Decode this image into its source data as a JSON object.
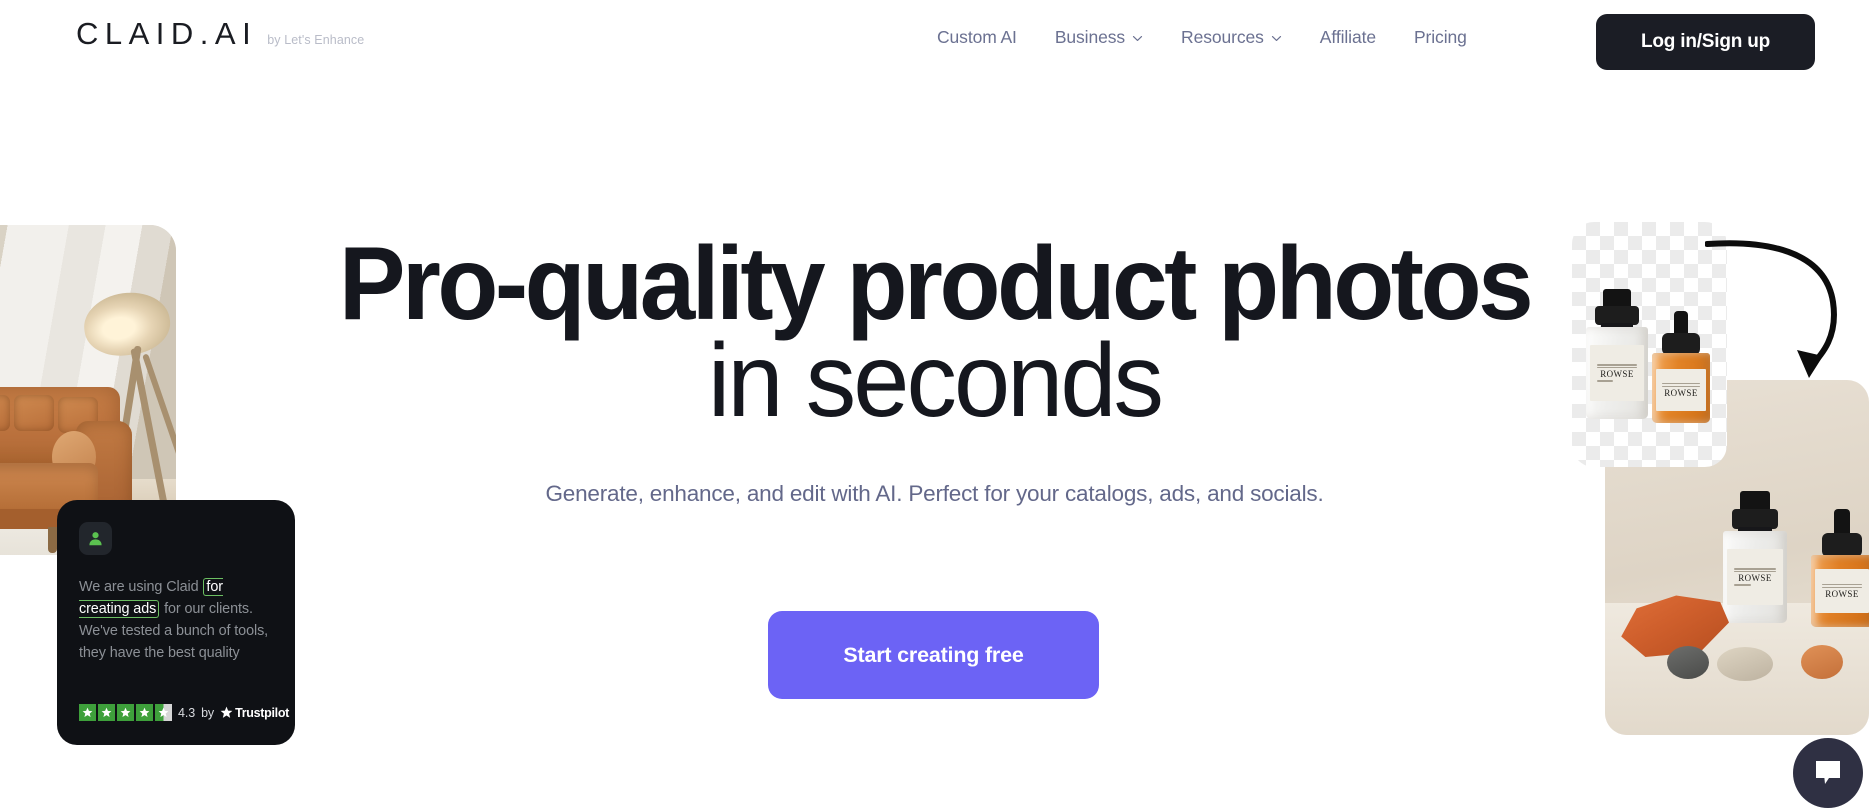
{
  "header": {
    "logo_text": "CLAID.AI",
    "logo_subtitle": "by Let's Enhance",
    "nav_items": [
      {
        "label": "Custom AI",
        "has_dropdown": false
      },
      {
        "label": "Business",
        "has_dropdown": true
      },
      {
        "label": "Resources",
        "has_dropdown": true
      },
      {
        "label": "Affiliate",
        "has_dropdown": false
      },
      {
        "label": "Pricing",
        "has_dropdown": false
      }
    ],
    "login_button": "Log in/Sign up"
  },
  "hero": {
    "headline_line1": "Pro-quality product photos",
    "headline_line2": "in seconds",
    "subheadline": "Generate, enhance, and edit with AI. Perfect for your catalogs, ads, and socials.",
    "cta_label": "Start creating free"
  },
  "testimonial": {
    "quote_before": "We are using Claid ",
    "quote_highlight": "for creating ads",
    "quote_after": " for our clients. We've tested a bunch of tools, they have the best quality",
    "rating_score": "4.3",
    "rating_by": "by",
    "rating_source": "Trustpilot",
    "stars_full": 4,
    "stars_half": 1
  },
  "images": {
    "left_image_alt": "leather sofa in living room",
    "cutout_alt": "ROWSE bottles on transparent background",
    "result_alt": "ROWSE bottles styled product photo",
    "product_brand": "ROWSE"
  },
  "chat": {
    "label": "chat-bubble"
  },
  "colors": {
    "accent_purple": "#6c63f5",
    "dark": "#1b1d25",
    "nav_text": "#6b7191",
    "card_dark": "#0f1115",
    "star_green": "#3ea03b",
    "chat_bg": "#2f3043"
  }
}
